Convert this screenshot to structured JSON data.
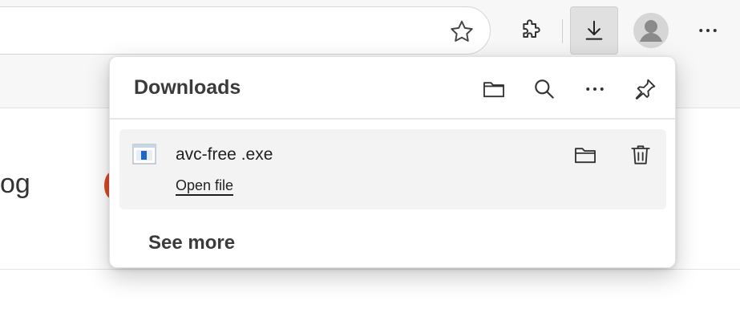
{
  "browser": {
    "icons": {
      "favorite": "star-icon",
      "extensions": "puzzle-icon",
      "downloads": "download-icon",
      "profile": "avatar-icon",
      "more": "more-icon"
    },
    "page_fragment": "og"
  },
  "downloads_panel": {
    "title": "Downloads",
    "header_icons": [
      "open-folder-icon",
      "search-icon",
      "more-icon",
      "pin-icon"
    ],
    "items": [
      {
        "file_name": "avc-free .exe",
        "action_label": "Open file",
        "icons": [
          "show-in-folder-icon",
          "delete-icon"
        ]
      }
    ],
    "see_more_label": "See more"
  },
  "colors": {
    "toolbar_bg": "#f7f7f7",
    "active_button_bg": "#e0e0e0",
    "item_bg": "#f3f3f3",
    "text": "#1b1b1b"
  }
}
